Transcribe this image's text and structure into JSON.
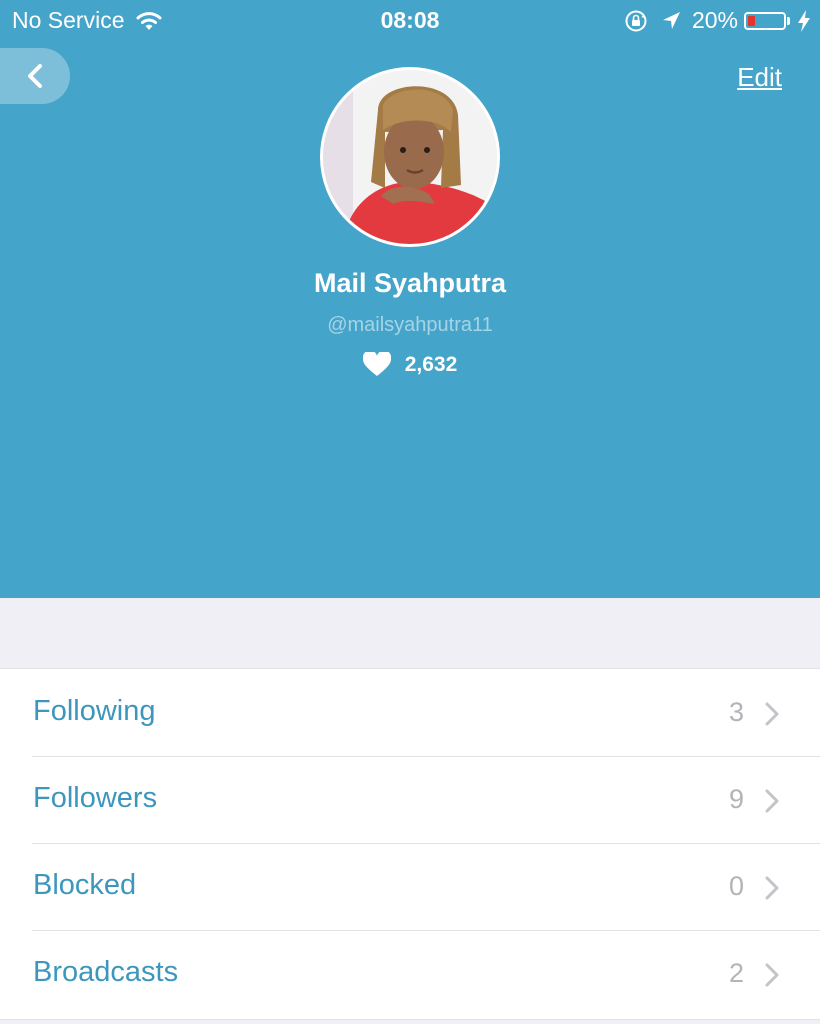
{
  "status_bar": {
    "carrier": "No Service",
    "time": "08:08",
    "battery_percent": "20%",
    "battery_level": 0.2,
    "icons": [
      "wifi-icon",
      "orientation-lock-icon",
      "location-arrow-icon",
      "battery-icon",
      "charging-bolt-icon"
    ]
  },
  "header": {
    "back_icon": "chevron-left-icon",
    "edit_label": "Edit",
    "background_color": "#45a4c9"
  },
  "profile": {
    "name": "Mail Syahputra",
    "handle": "@mailsyahputra11",
    "likes_count": "2,632",
    "likes_icon": "heart-icon"
  },
  "menu": {
    "items": [
      {
        "label": "Following",
        "count": "3"
      },
      {
        "label": "Followers",
        "count": "9"
      },
      {
        "label": "Blocked",
        "count": "0"
      },
      {
        "label": "Broadcasts",
        "count": "2"
      }
    ],
    "label_color": "#3d97bd"
  }
}
